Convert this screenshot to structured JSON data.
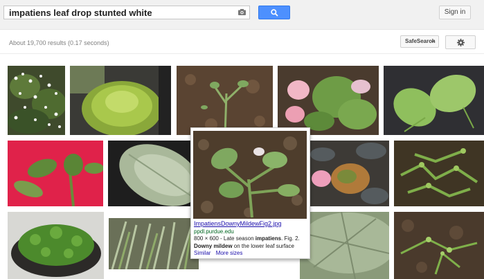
{
  "search": {
    "query": "impatiens leaf drop stunted white"
  },
  "header": {
    "signin_label": "Sign in"
  },
  "tools": {
    "results_stats": "About 19,700 results (0.17 seconds)",
    "safesearch_label": "SafeSearch"
  },
  "popup": {
    "title": "ImpatiensDownyMildewFig2.jpg",
    "domain": "ppdl.purdue.edu",
    "desc_prefix": "800 × 600 - Late season ",
    "desc_bold1": "impatiens",
    "desc_mid": ". Fig. 2. ",
    "desc_bold2": "Downy mildew",
    "desc_suffix": " on the lower leaf surface",
    "similar_label": "Similar",
    "more_sizes_label": "More sizes"
  },
  "colors": {
    "search_button": "#4d90fe",
    "link": "#1a0dab",
    "url_green": "#006621"
  }
}
